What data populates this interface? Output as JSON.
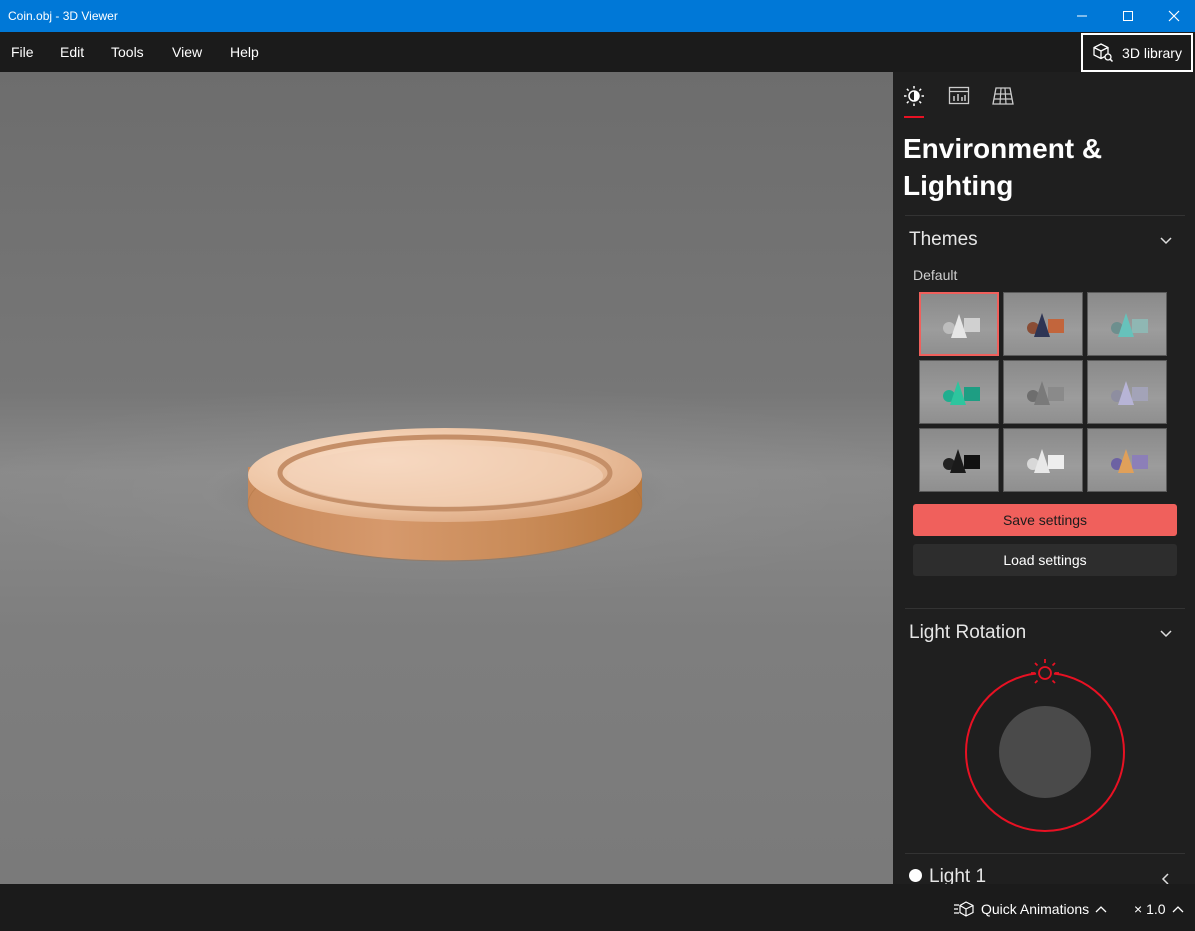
{
  "window": {
    "title": "Coin.obj - 3D Viewer"
  },
  "menu": {
    "items": [
      "File",
      "Edit",
      "Tools",
      "View",
      "Help"
    ],
    "library_label": "3D library"
  },
  "panel": {
    "heading": "Environment & Lighting",
    "themes": {
      "title": "Themes",
      "current": "Default",
      "selected_index": 0
    },
    "save_label": "Save settings",
    "load_label": "Load settings",
    "light_rotation": {
      "title": "Light Rotation"
    },
    "light1": {
      "label": "Light 1"
    }
  },
  "status": {
    "animations_label": "Quick Animations",
    "speed": "× 1.0"
  },
  "colors": {
    "accent": "#e81123",
    "button": "#f0605c",
    "titlebar": "#0078d7",
    "coin": "#d4a27c"
  }
}
